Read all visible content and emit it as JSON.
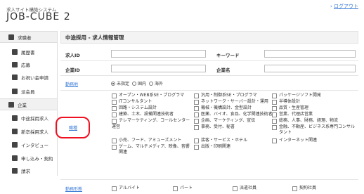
{
  "header": {
    "subtitle": "求人サイト構築システム",
    "logo": "JOB-CUBE 2",
    "logout": "ログアウト"
  },
  "sidebar": {
    "items": [
      {
        "label": "求職者",
        "type": "group",
        "icon": "person-icon"
      },
      {
        "label": "履歴書",
        "type": "sub",
        "icon": "document-icon"
      },
      {
        "label": "応募",
        "type": "sub",
        "icon": "inbox-icon"
      },
      {
        "label": "お祝い金申請",
        "type": "sub",
        "icon": "money-icon"
      },
      {
        "label": "派会員",
        "type": "sub",
        "icon": "person-icon"
      },
      {
        "label": "企業",
        "type": "group",
        "icon": "people-icon"
      },
      {
        "label": "中途採用求人",
        "type": "sub",
        "icon": "people-icon"
      },
      {
        "label": "新卒採用求人",
        "type": "sub",
        "icon": "people-icon"
      },
      {
        "label": "インタビュー",
        "type": "sub",
        "icon": "people-icon"
      },
      {
        "label": "申し込み・契約",
        "type": "sub",
        "icon": "link-icon"
      },
      {
        "label": "請求",
        "type": "sub",
        "icon": "grid-icon"
      }
    ]
  },
  "main": {
    "title": "中途採用 - 求人情報管理",
    "form": {
      "job_id_label": "求人ID",
      "keyword_label": "キーワード",
      "company_id_label": "企業ID",
      "company_name_label": "企業名",
      "location_link": "勤務地",
      "location_options": [
        "未指定",
        "国内",
        "海外"
      ],
      "location_selected": "未指定",
      "occupation_link": "職種",
      "occupations": [
        "オープン・WEB系SE・プログラマ",
        "汎用・制御系SE・プログラマ",
        "パッケージソフト開発",
        "ITコンサルタント",
        "ネットワーク・サーバー設計・運用",
        "半導体設計",
        "回路・システム設計",
        "機械・機構設計、金型設計",
        "品質・生産管理",
        "建築、土木、設備関連技術者",
        "医薬、バイオ、食品、化学関連技術者",
        "営業、代理店営業",
        "テレマーケティング、コールセンター",
        "企画、マーケティング、宣伝",
        "総務、人事、財務、経理、物流",
        "運営",
        "事務、受付、秘書",
        "金融、不動産、ビジネス系専門コンサルタント",
        "小売、フード、アミューズメント",
        "接客・サービス・ホテル",
        "インターネット関連",
        "ゲーム、マルチメディア、映像、音響関連",
        "出版・印刷関連"
      ],
      "employment_link": "勤務形態",
      "employment_types": [
        "アルバイト",
        "パート",
        "派遣社員",
        "契約社員"
      ]
    }
  }
}
